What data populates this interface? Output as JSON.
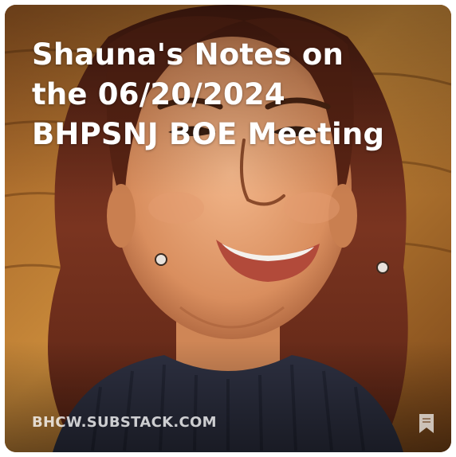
{
  "card": {
    "title_lines": [
      "Shauna's Notes on",
      "the 06/20/2024",
      "BHPSNJ BOE Meeting"
    ],
    "domain": "BHCW.SUBSTACK.COM",
    "bookmark_icon": "bookmark-icon",
    "image_subject": "cartoon-style portrait"
  },
  "colors": {
    "title_text": "#ffffff",
    "domain_text": "#e8ddd2",
    "background_warm": "#c98a3a",
    "hair": "#6a2e1a",
    "sweater": "#2e3142"
  }
}
